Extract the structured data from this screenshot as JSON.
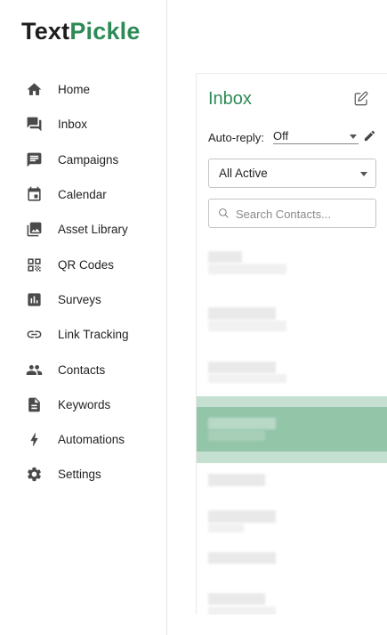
{
  "brand": {
    "part1": "Text",
    "part2": "Pickle",
    "accent": "#2e8b57"
  },
  "sidebar": {
    "items": [
      {
        "label": "Home",
        "icon": "home-icon"
      },
      {
        "label": "Inbox",
        "icon": "forum-icon"
      },
      {
        "label": "Campaigns",
        "icon": "message-icon"
      },
      {
        "label": "Calendar",
        "icon": "calendar-icon"
      },
      {
        "label": "Asset Library",
        "icon": "photo-library-icon"
      },
      {
        "label": "QR Codes",
        "icon": "qr-code-icon"
      },
      {
        "label": "Surveys",
        "icon": "poll-icon"
      },
      {
        "label": "Link Tracking",
        "icon": "link-icon"
      },
      {
        "label": "Contacts",
        "icon": "people-icon"
      },
      {
        "label": "Keywords",
        "icon": "document-icon"
      },
      {
        "label": "Automations",
        "icon": "bolt-icon"
      },
      {
        "label": "Settings",
        "icon": "gear-icon"
      }
    ]
  },
  "inbox": {
    "title": "Inbox",
    "auto_reply_label": "Auto-reply:",
    "auto_reply_value": "Off",
    "filter_value": "All Active",
    "search_placeholder": "Search Contacts...",
    "selected_color": "#93c5a9"
  }
}
